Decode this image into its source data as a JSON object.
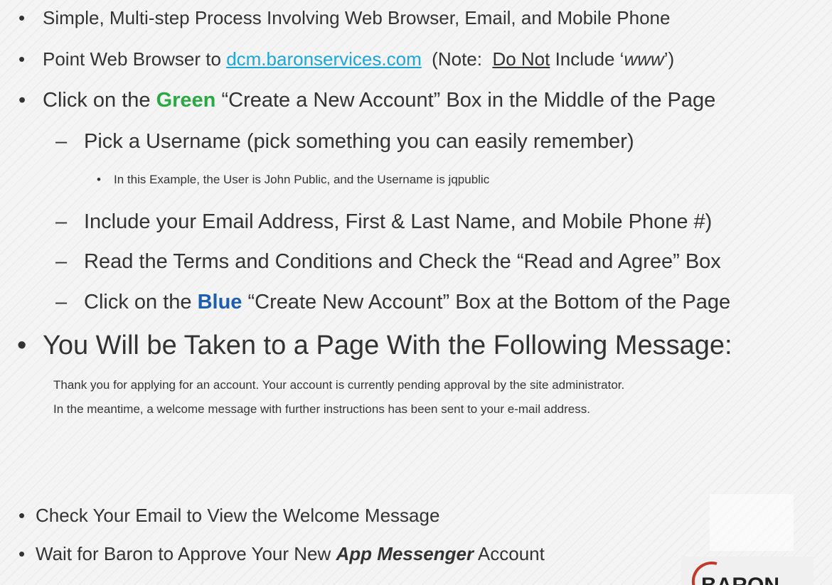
{
  "bullets": {
    "b1": "Simple, Multi-step Process Involving Web Browser, Email, and Mobile Phone",
    "b2": {
      "prefix": "Point Web Browser to ",
      "link": "dcm.baronservices.com",
      "mid": "  (Note:  ",
      "underlined": "Do Not",
      "mid2": " Include ‘",
      "italic": "www",
      "suffix": "’)"
    },
    "b3": {
      "prefix": "Click on the ",
      "green": "Green",
      "suffix": " “Create a New Account” Box in the Middle of the Page"
    },
    "sub1": "Pick a Username (pick something you can easily remember)",
    "subsub1": "In this Example, the User is John Public, and the Username is jqpublic",
    "sub2": "Include your Email Address, First & Last Name, and Mobile Phone #)",
    "sub3": "Read the Terms and Conditions and Check the “Read and Agree” Box",
    "sub4": {
      "prefix": "Click on the ",
      "blue": "Blue",
      "suffix": " “Create New Account” Box at the Bottom of the Page"
    },
    "b4": "You Will be Taken to a Page With the Following Message:",
    "message_line1": "Thank you for applying for an account. Your account is currently pending approval by the site administrator.",
    "message_line2": "In the meantime, a welcome message with further instructions has been sent to your e-mail address.",
    "b5": "Check Your Email to View the Welcome Message",
    "b6": {
      "prefix": "Wait for Baron to Approve Your New ",
      "bold_italic": "App Messenger",
      "suffix": " Account"
    }
  },
  "symbols": {
    "bullet": "•",
    "dash": "–"
  },
  "logo": {
    "text": "BARON",
    "ring_color": "#c0392b"
  },
  "colors": {
    "green": "#2aa843",
    "blue": "#1b5fae",
    "link": "#1aa6d9",
    "text": "#333333"
  }
}
